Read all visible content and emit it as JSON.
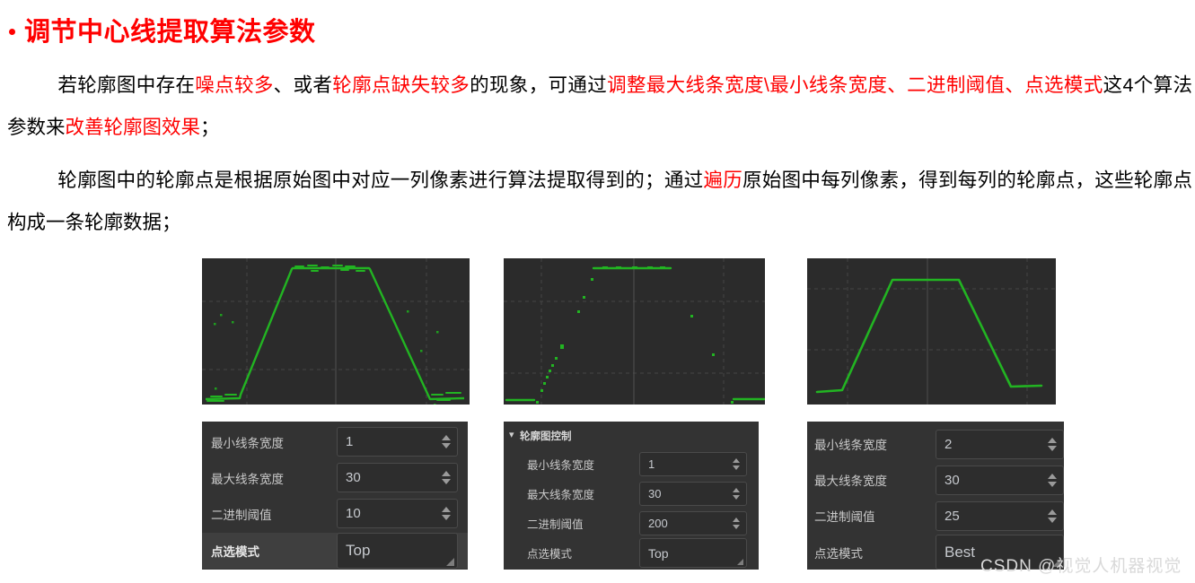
{
  "heading": {
    "bullet": "bullet-dot",
    "text": "调节中心线提取算法参数"
  },
  "paragraphs": {
    "p1": [
      {
        "text": "若轮廓图中存在",
        "color": "black"
      },
      {
        "text": "噪点较多",
        "color": "red"
      },
      {
        "text": "、或者",
        "color": "black"
      },
      {
        "text": "轮廓点缺失较多",
        "color": "red"
      },
      {
        "text": "的现象，可通过",
        "color": "black"
      },
      {
        "text": "调整最大线条宽度\\最小线条宽度、二进制阈值、点选模式",
        "color": "red"
      },
      {
        "text": "这4个算法参数来",
        "color": "black"
      },
      {
        "text": "改善轮廓图效果",
        "color": "red"
      },
      {
        "text": "；",
        "color": "black"
      }
    ],
    "p2": [
      {
        "text": "轮廓图中的轮廓点是根据原始图中对应一列像素进行算法提取得到的；通过",
        "color": "black"
      },
      {
        "text": "遍历",
        "color": "red"
      },
      {
        "text": "原始图中每列像素，得到每列的轮廓点，这些轮廓点构成一条轮廓数据；",
        "color": "black"
      }
    ]
  },
  "colors": {
    "accent_red": "#ff0000",
    "plot_background": "#2b2b2b",
    "plot_trace": "#22b422",
    "panel_background": "#333333",
    "field_background": "#2d2d2d",
    "field_border": "#4a4a4a",
    "label_text": "#c9c9c9"
  },
  "plots": [
    {
      "name": "profile-plot-noisy",
      "trace_color": "#22b422",
      "description": "trapezoid profile with noisy top plateau and scattered noise points"
    },
    {
      "name": "profile-plot-missing",
      "trace_color": "#22b422",
      "description": "profile with missing contour points on the rising ramp and absent falling edge"
    },
    {
      "name": "profile-plot-clean",
      "trace_color": "#22b422",
      "description": "clean trapezoid profile after parameter tuning"
    }
  ],
  "panels": [
    {
      "name": "param-panel-left",
      "has_header": false,
      "header_title": "",
      "rows": [
        {
          "label": "最小线条宽度",
          "value": "1",
          "control": "spinner",
          "highlight": false
        },
        {
          "label": "最大线条宽度",
          "value": "30",
          "control": "spinner",
          "highlight": false
        },
        {
          "label": "二进制阈值",
          "value": "10",
          "control": "spinner",
          "highlight": false
        },
        {
          "label": "点选模式",
          "value": "Top",
          "control": "combobox",
          "highlight": true
        }
      ]
    },
    {
      "name": "param-panel-middle",
      "has_header": true,
      "header_title": "轮廓图控制",
      "header_icon": "chevron-down-icon",
      "rows": [
        {
          "label": "最小线条宽度",
          "value": "1",
          "control": "spinner",
          "highlight": false
        },
        {
          "label": "最大线条宽度",
          "value": "30",
          "control": "spinner",
          "highlight": false
        },
        {
          "label": "二进制阈值",
          "value": "200",
          "control": "spinner",
          "highlight": false
        },
        {
          "label": "点选模式",
          "value": "Top",
          "control": "combobox",
          "highlight": false
        }
      ]
    },
    {
      "name": "param-panel-right",
      "has_header": false,
      "header_title": "",
      "rows": [
        {
          "label": "最小线条宽度",
          "value": "2",
          "control": "spinner",
          "highlight": false
        },
        {
          "label": "最大线条宽度",
          "value": "30",
          "control": "spinner",
          "highlight": false
        },
        {
          "label": "二进制阈值",
          "value": "25",
          "control": "spinner",
          "highlight": false
        },
        {
          "label": "点选模式",
          "value": "Best",
          "control": "combobox",
          "highlight": false
        }
      ]
    }
  ],
  "watermark": {
    "text": "CSDN @视觉人机器视觉"
  }
}
